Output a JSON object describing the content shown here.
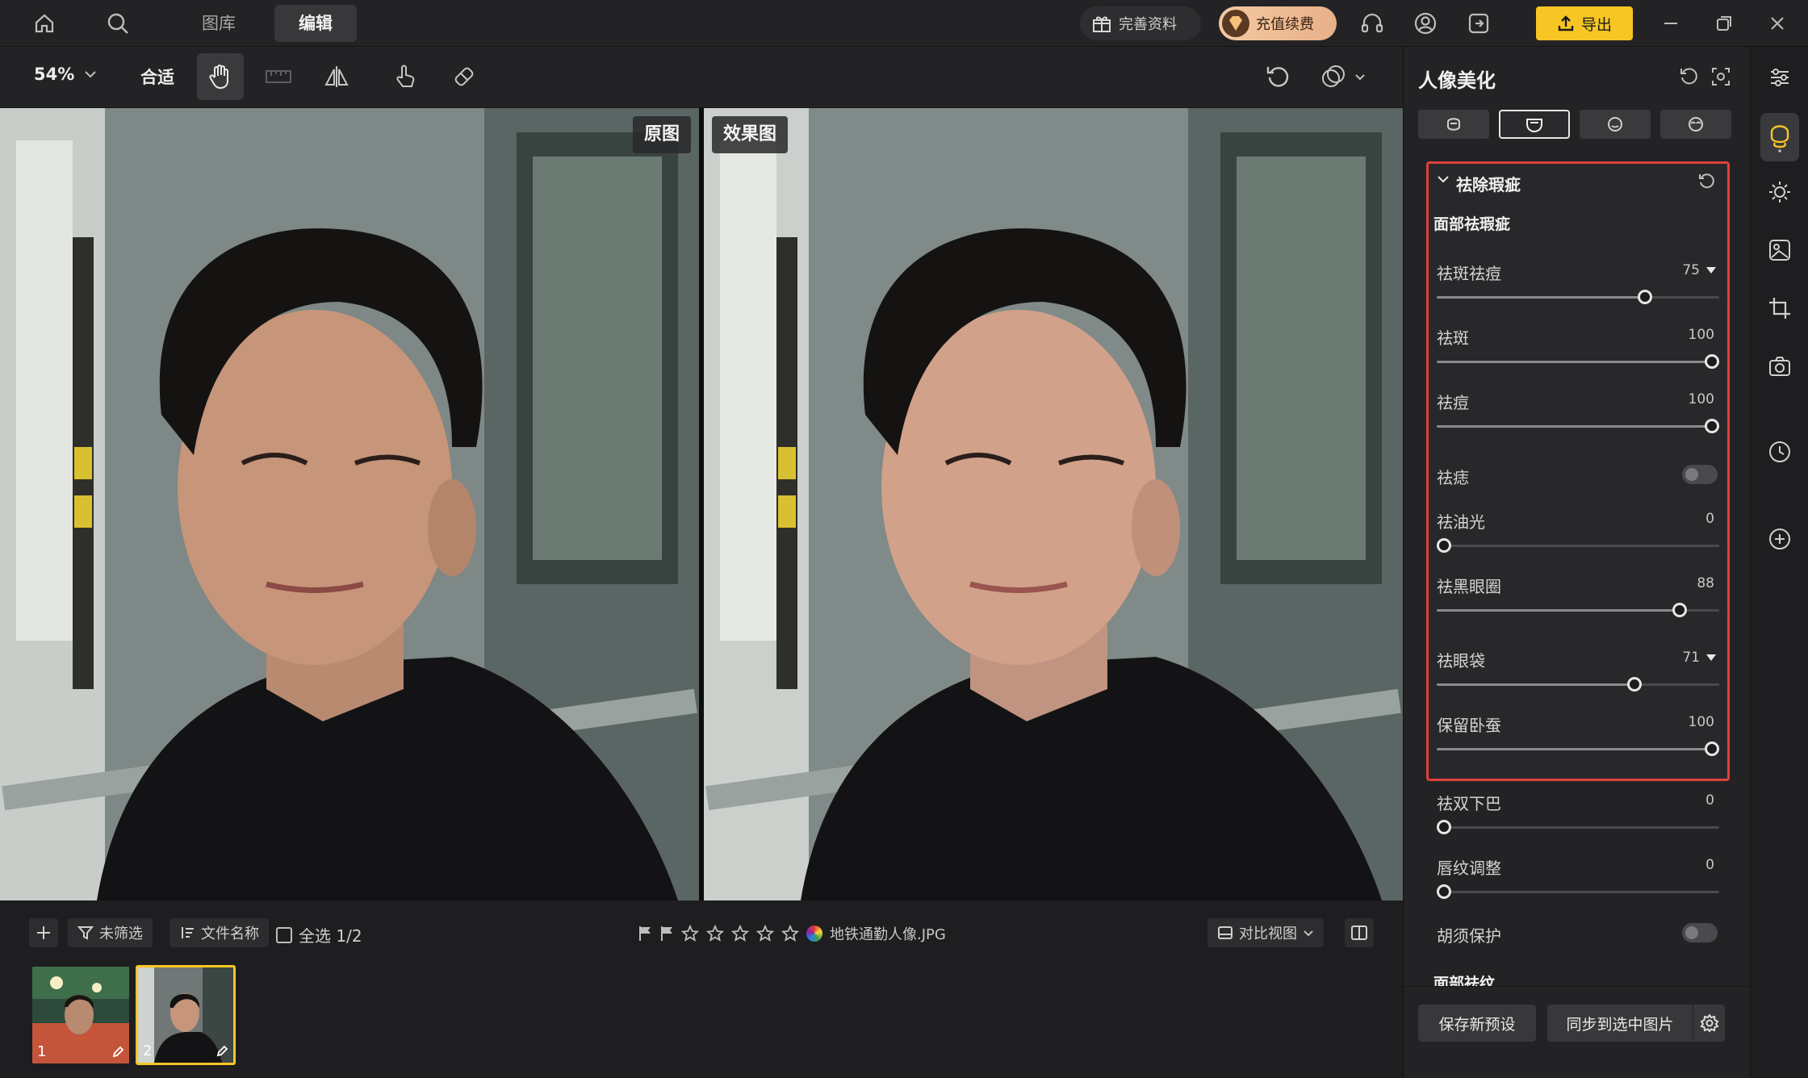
{
  "top_nav": {
    "tab_gallery": "图库",
    "tab_edit": "编辑",
    "profile_btn": "完善资料",
    "recharge_btn": "充值续费",
    "export_btn": "导出"
  },
  "toolbar": {
    "zoom": "54%",
    "fit": "合适"
  },
  "canvas": {
    "original_label": "原图",
    "result_label": "效果图"
  },
  "filter_bar": {
    "unfiltered": "未筛选",
    "filename_sort": "文件名称",
    "select_all": "全选 1/2",
    "file_name": "地铁通勤人像.JPG",
    "compare_view": "对比视图"
  },
  "filmstrip": [
    {
      "num": "1"
    },
    {
      "num": "2"
    }
  ],
  "panel": {
    "title": "人像美化",
    "section_title": "祛除瑕疵",
    "group_title": "面部祛瑕疵",
    "sliders": {
      "spot_acne": {
        "label": "祛斑祛痘",
        "value": "75",
        "level": 0.75
      },
      "spot": {
        "label": "祛斑",
        "value": "100",
        "level": 1.0
      },
      "acne": {
        "label": "祛痘",
        "value": "100",
        "level": 1.0
      },
      "mole": {
        "label": "祛痣"
      },
      "oil": {
        "label": "祛油光",
        "value": "0",
        "level": 0
      },
      "dark_circle": {
        "label": "祛黑眼圈",
        "value": "88",
        "level": 0.88
      },
      "eye_bag": {
        "label": "祛眼袋",
        "value": "71",
        "level": 0.71
      },
      "keep_silkworm": {
        "label": "保留卧蚕",
        "value": "100",
        "level": 1.0
      },
      "double_chin": {
        "label": "祛双下巴",
        "value": "0",
        "level": 0
      },
      "lip_lines": {
        "label": "唇纹调整",
        "value": "0",
        "level": 0
      },
      "beard": {
        "label": "胡须保护"
      }
    },
    "next_group": "面部祛纹",
    "save_preset": "保存新预设",
    "sync_btn": "同步到选中图片"
  },
  "colors": {
    "accent_yellow": "#f7c624",
    "highlight_red": "#e0403b"
  }
}
